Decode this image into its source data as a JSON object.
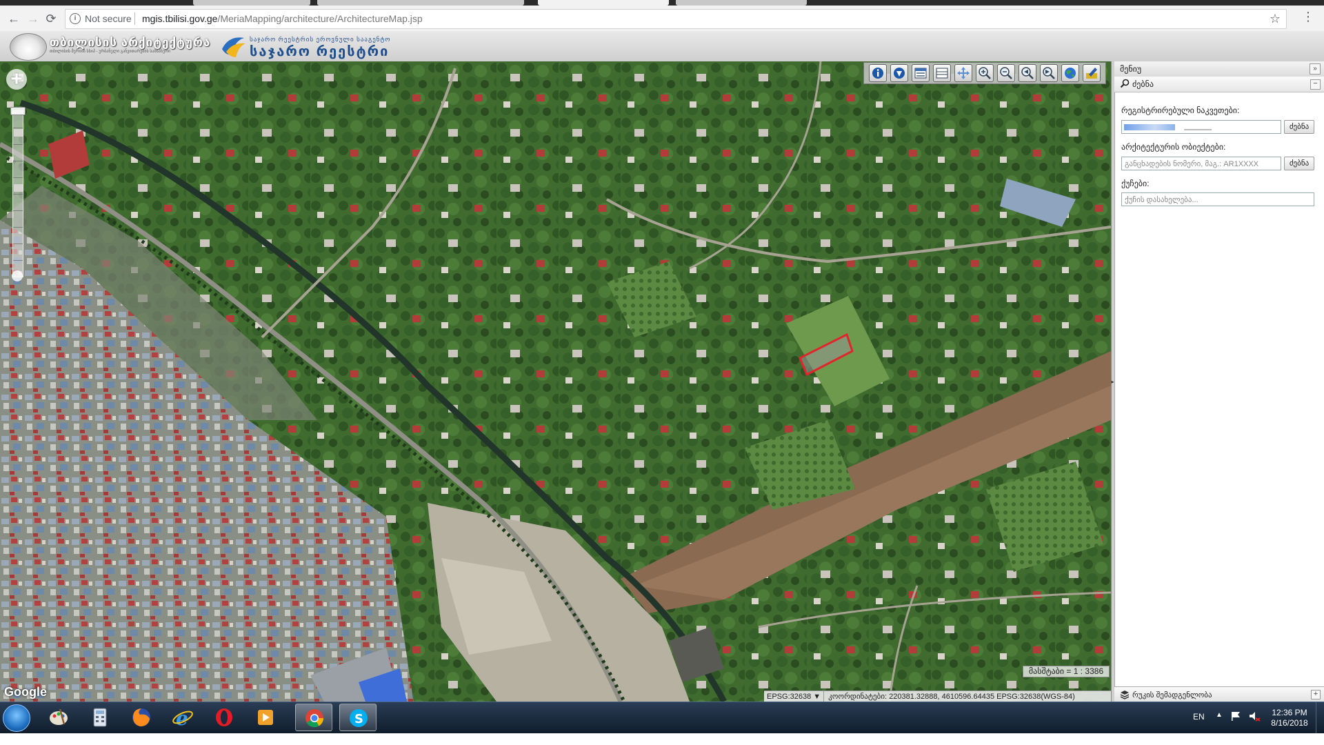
{
  "browser": {
    "nav": {
      "back": "←",
      "forward": "→",
      "reload": "⟳"
    },
    "security": "Not secure",
    "url_host": "mgis.tbilisi.gov.ge",
    "url_path": "/MeriaMapping/architecture/ArchitectureMap.jsp",
    "star": "☆",
    "menu": "⋮"
  },
  "site_header": {
    "logo1_text": "თბილისის არქიტექტურა",
    "logo1_sub": "თბილისის მერიის სსიპ - ურბანული განვითარების სამსახური",
    "logo2_line1": "საჯარო რეესტრის ეროვნული სააგენტო",
    "logo2_line2": "საჯარო რეესტრი"
  },
  "map": {
    "zoom_in": "+",
    "attribution": "Google",
    "scale_text": "მასშტაბი = 1 : 3386",
    "epsg_select": "EPSG:32638 ▼",
    "coords_text": "კოორდინატები: 220381.32888, 4610596.64435   EPSG:32638(WGS-84)",
    "tools": [
      {
        "name": "info-tool",
        "icon": "info-icon"
      },
      {
        "name": "identify-tool",
        "icon": "pin-icon"
      },
      {
        "name": "layers-tool",
        "icon": "layers-icon"
      },
      {
        "name": "legend-tool",
        "icon": "table-icon"
      },
      {
        "name": "pan-tool",
        "icon": "pan-arrows-icon"
      },
      {
        "name": "zoom-in-tool",
        "icon": "zoom-in-icon"
      },
      {
        "name": "zoom-out-tool",
        "icon": "zoom-out-icon"
      },
      {
        "name": "zoom-previous-tool",
        "icon": "zoom-prev-icon"
      },
      {
        "name": "zoom-next-tool",
        "icon": "zoom-next-icon"
      },
      {
        "name": "full-extent-tool",
        "icon": "globe-icon"
      },
      {
        "name": "print-tool",
        "icon": "pencil-icon"
      }
    ]
  },
  "panel": {
    "title": "მენიუ",
    "collapse": "»",
    "search_header": "ძებნა",
    "search_collapse": "−",
    "cadastral_label": "რეგისტრირებული ნაკვეთები:",
    "cadastral_button": "ძებნა",
    "arch_label": "არქიტექტურის ობიექტები:",
    "arch_placeholder": "განცხადების ნომერი, მაგ.: AR1XXXX",
    "arch_button": "ძებნა",
    "street_label": "ქუჩები:",
    "street_placeholder": "ქუჩის დასახელება...",
    "footer_label": "რუკის შემადგენლობა",
    "footer_plus": "+"
  },
  "taskbar": {
    "language": "EN",
    "tray_arrow": "▲",
    "time": "12:36 PM",
    "date": "8/16/2018"
  },
  "colors": {
    "brand_blue": "#1f4f8c",
    "parcel_outline": "#e0262b",
    "vegetation": "#3f6b2f"
  }
}
